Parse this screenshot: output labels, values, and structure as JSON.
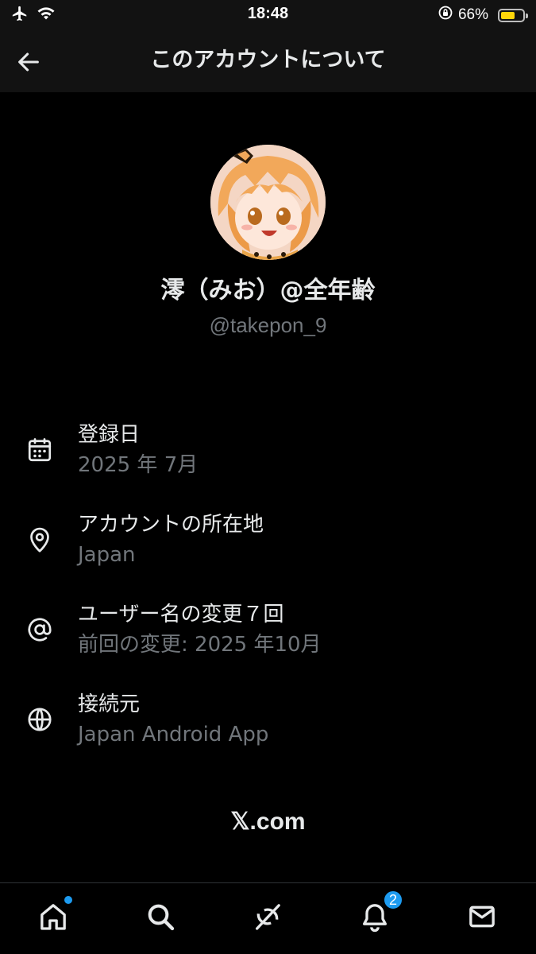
{
  "status_bar": {
    "time": "18:48",
    "battery_text": "66%",
    "battery_level": 0.66,
    "icons": [
      "airplane-icon",
      "wifi-icon",
      "orientation-lock-icon",
      "battery-icon"
    ]
  },
  "header": {
    "title": "このアカウントについて",
    "back_icon": "back-arrow-icon"
  },
  "profile": {
    "display_name": "澪（みお）@全年齢",
    "handle": "@takepon_9",
    "avatar_icon": "avatar-image"
  },
  "info": [
    {
      "icon": "calendar-icon",
      "label": "登録日",
      "value": "2025 年 7月"
    },
    {
      "icon": "location-pin-icon",
      "label": "アカウントの所在地",
      "value": "Japan"
    },
    {
      "icon": "at-sign-icon",
      "label": "ユーザー名の変更７回",
      "value": "前回の変更: 2025 年10月"
    },
    {
      "icon": "globe-icon",
      "label": "接続元",
      "value": "Japan Android App"
    }
  ],
  "footer": {
    "brand": "𝕏.com"
  },
  "tabs": [
    {
      "name": "home",
      "icon": "home-icon",
      "has_dot": true
    },
    {
      "name": "search",
      "icon": "search-icon"
    },
    {
      "name": "grok",
      "icon": "grok-icon"
    },
    {
      "name": "notifications",
      "icon": "bell-icon",
      "badge": "2"
    },
    {
      "name": "messages",
      "icon": "mail-icon"
    }
  ],
  "colors": {
    "background": "#000000",
    "bar_background": "#121212",
    "text_primary": "#e7e9ea",
    "text_secondary": "#71767b",
    "accent": "#1d9bf0",
    "battery": "#ffd60a"
  }
}
